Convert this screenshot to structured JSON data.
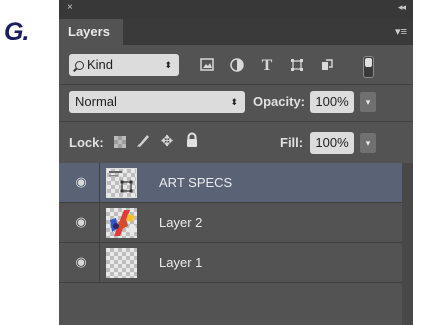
{
  "figure_label": "G.",
  "window": {
    "close": "×",
    "collapse": "◂◂"
  },
  "panel": {
    "tab_title": "Layers",
    "menu_icon": "panel-menu-icon"
  },
  "filter": {
    "kind_label": "Kind",
    "icons": [
      "pixel-layer-filter-icon",
      "adjustment-filter-icon",
      "type-filter-icon",
      "shape-filter-icon",
      "smart-object-filter-icon"
    ]
  },
  "blend": {
    "mode": "Normal",
    "opacity_label": "Opacity:",
    "opacity_value": "100%"
  },
  "lock": {
    "label": "Lock:",
    "fill_label": "Fill:",
    "fill_value": "100%"
  },
  "layers": [
    {
      "name": "ART SPECS",
      "selected": true,
      "visible": true
    },
    {
      "name": "Layer 2",
      "selected": false,
      "visible": true
    },
    {
      "name": "Layer 1",
      "selected": false,
      "visible": true
    }
  ],
  "colors": {
    "panel": "#535353",
    "selected": "#5a6375",
    "figure_letter": "#1a1f5c"
  }
}
